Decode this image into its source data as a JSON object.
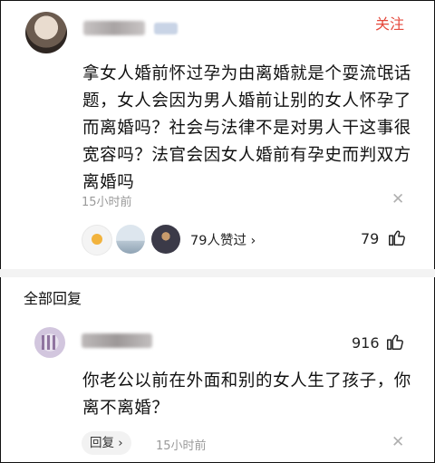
{
  "post": {
    "follow_label": "关注",
    "text": "拿女人婚前怀过孕为由离婚就是个耍流氓话题，女人会因为男人婚前让别的女人怀孕了而离婚吗？社会与法律不是对男人干这事很宽容吗？法官会因女人婚前有孕史而判双方离婚吗",
    "time": "15小时前",
    "likers_text": "79人赞过 ›",
    "like_count": "79"
  },
  "replies_section": {
    "title": "全部回复"
  },
  "reply": {
    "like_count": "916",
    "text": "你老公以前在外面和别的女人生了孩子，你离不离婚？",
    "reply_label": "回复 ›",
    "time": "15小时前"
  },
  "icons": {
    "close": "close-icon",
    "like": "thumbs-up-icon"
  },
  "colors": {
    "accent": "#e5493c",
    "muted": "#9a9a9a"
  }
}
